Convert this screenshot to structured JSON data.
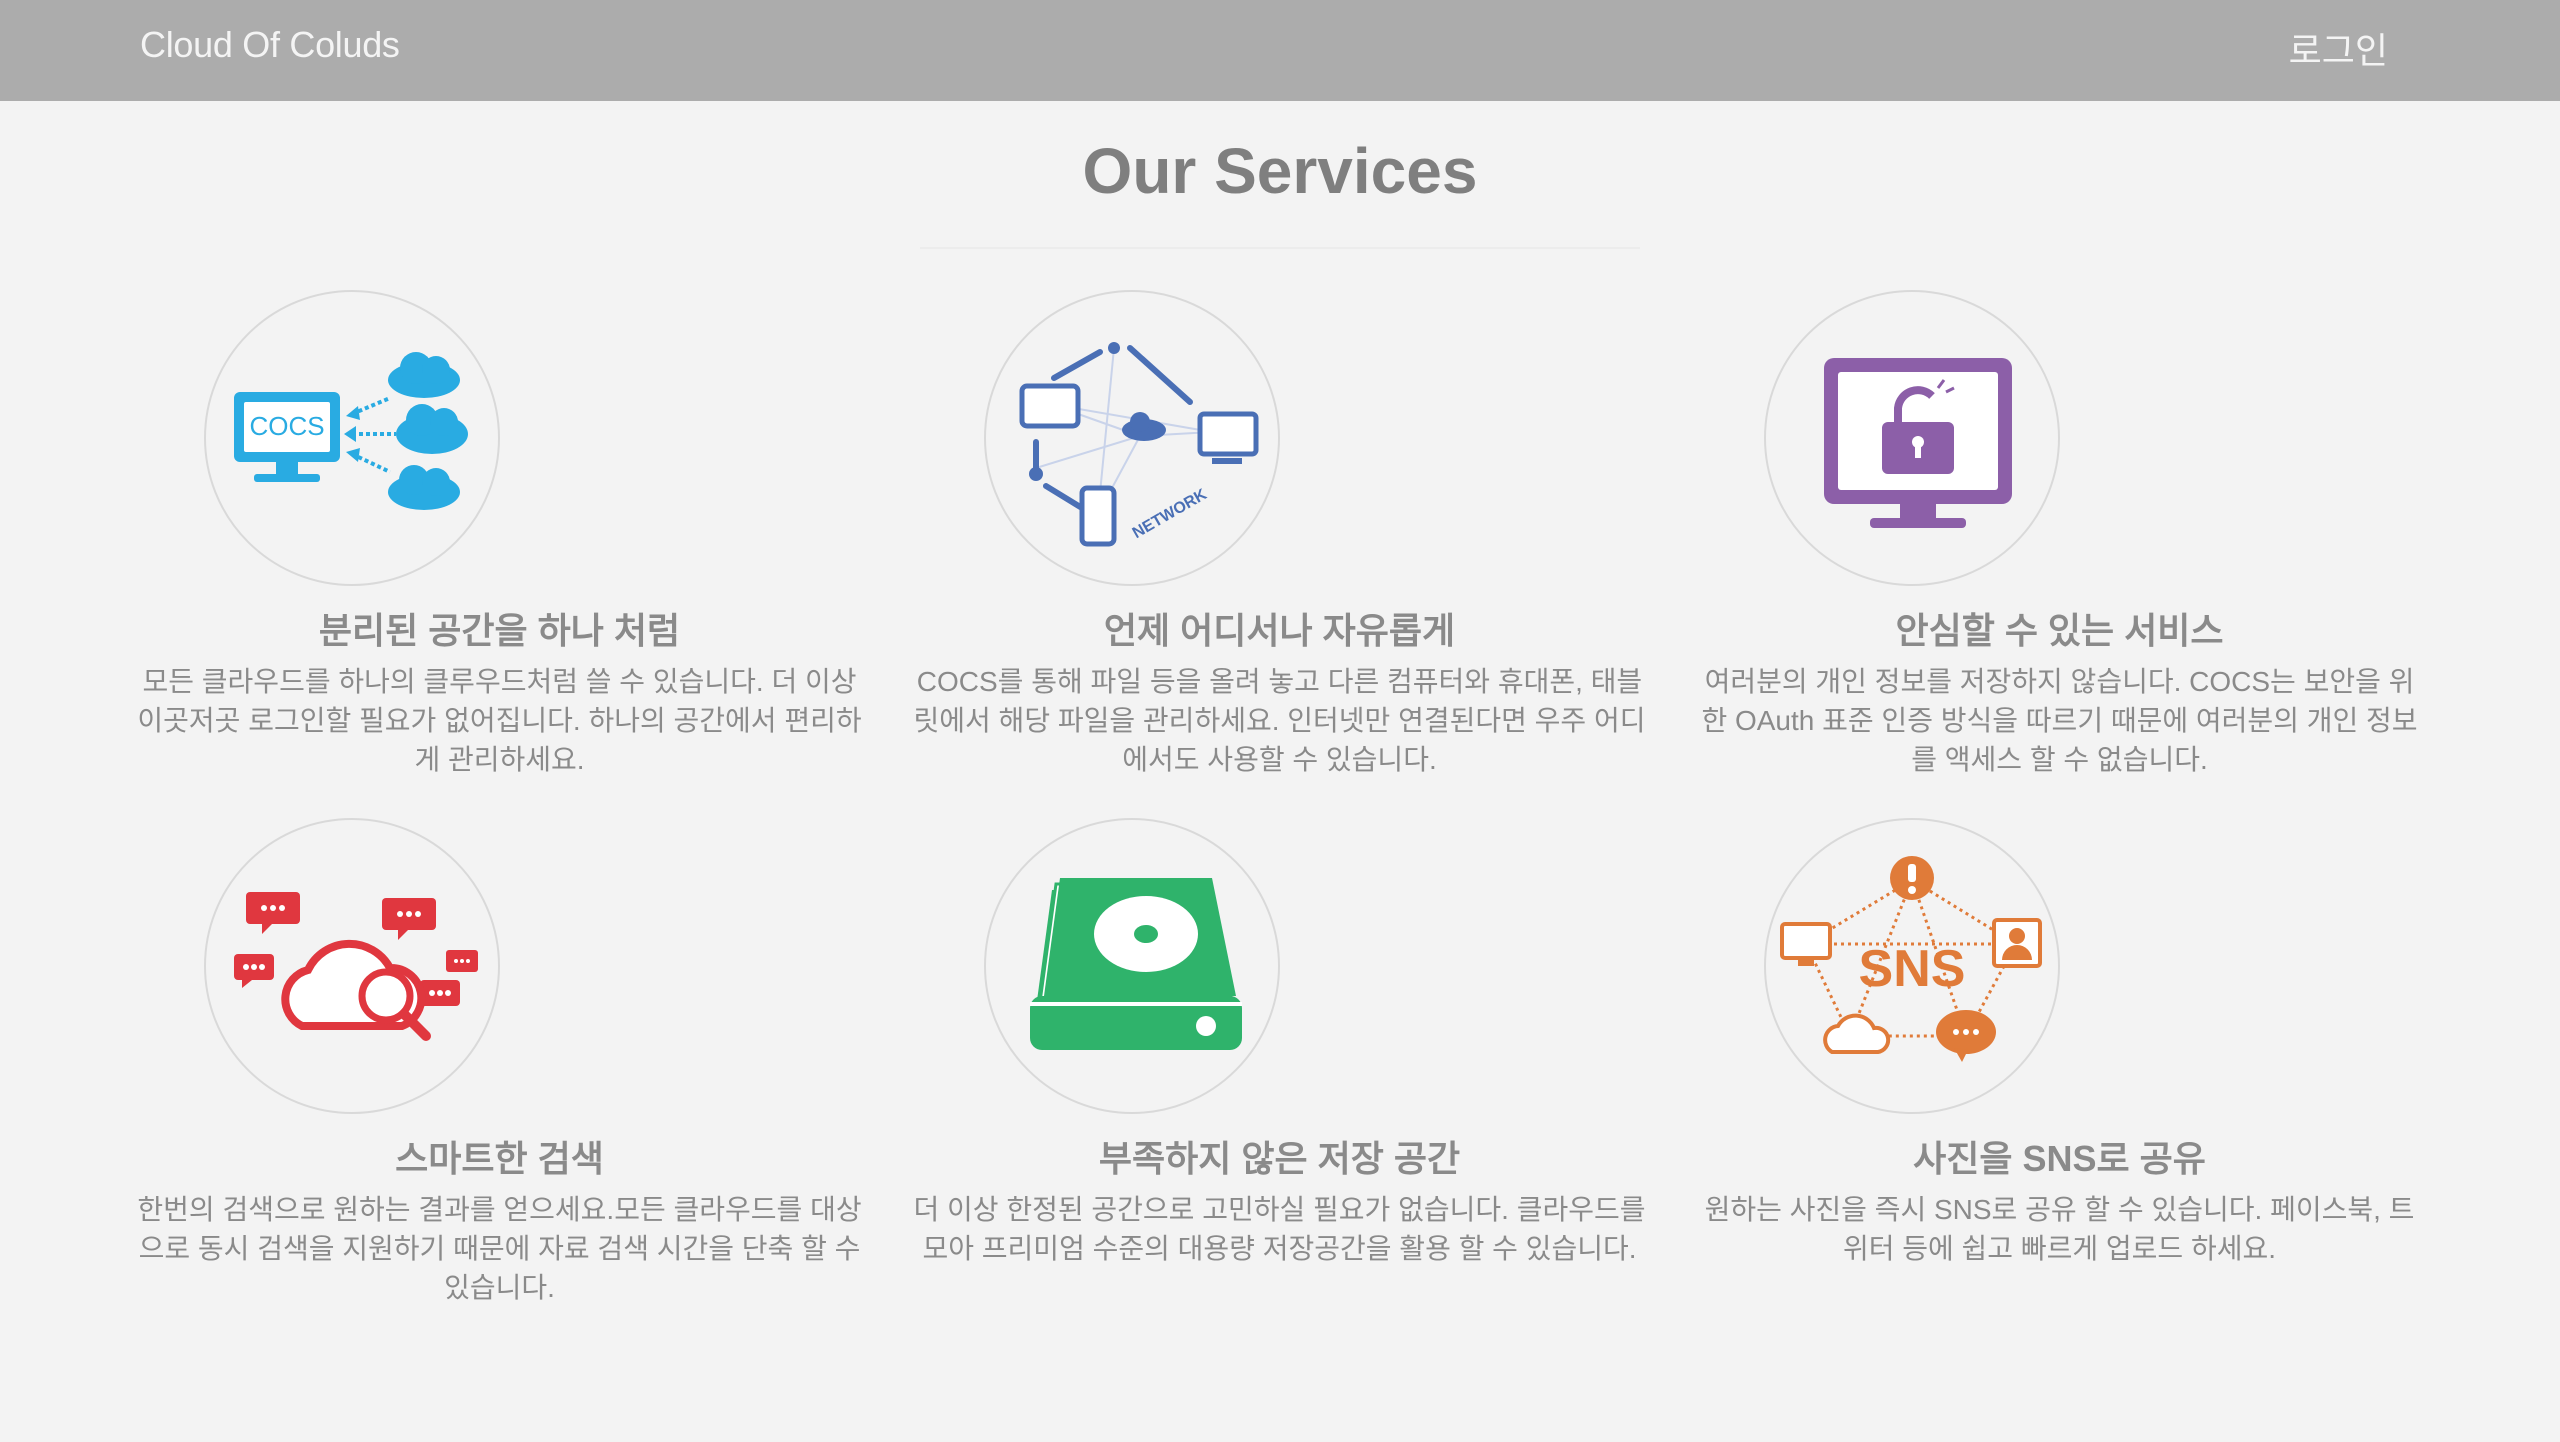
{
  "nav": {
    "brand": "Cloud Of Coluds",
    "login": "로그인"
  },
  "section_title": "Our Services",
  "services": [
    {
      "icon": "cloud-merge-icon",
      "icon_text": "COCS",
      "color": "#29abe2",
      "title": "분리된 공간을 하나 처럼",
      "desc": "모든 클라우드를 하나의 클루우드처럼 쓸 수 있습니다. 더 이상 이곳저곳 로그인할 필요가 없어집니다. 하나의 공간에서 편리하게 관리하세요."
    },
    {
      "icon": "network-icon",
      "icon_text": "NETWORK",
      "color": "#4a6fb5",
      "title": "언제 어디서나 자유롭게",
      "desc": "COCS를 통해 파일 등을 올려 놓고 다른 컴퓨터와 휴대폰, 태블릿에서 해당 파일을 관리하세요. 인터넷만 연결된다면 우주 어디에서도 사용할 수 있습니다."
    },
    {
      "icon": "secure-monitor-icon",
      "icon_text": "",
      "color": "#8c5fa8",
      "title": "안심할 수 있는 서비스",
      "desc": "여러분의 개인 정보를 저장하지 않습니다. COCS는 보안을 위한 OAuth 표준 인증 방식을 따르기 때문에 여러분의 개인 정보를 액세스 할 수 없습니다."
    },
    {
      "icon": "cloud-search-icon",
      "icon_text": "",
      "color": "#e0373f",
      "title": "스마트한 검색",
      "desc": "한번의 검색으로 원하는 결과를 얻으세요.모든 클라우드를 대상으로 동시 검색을 지원하기 때문에 자료 검색 시간을 단축 할 수 있습니다."
    },
    {
      "icon": "hard-drive-icon",
      "icon_text": "",
      "color": "#2fb36b",
      "title": "부족하지 않은 저장 공간",
      "desc": "더 이상 한정된 공간으로 고민하실 필요가 없습니다. 클라우드를 모아 프리미엄 수준의 대용량 저장공간을 활용 할 수 있습니다."
    },
    {
      "icon": "sns-share-icon",
      "icon_text": "SNS",
      "color": "#e07b39",
      "title": "사진을 SNS로 공유",
      "desc": "원하는 사진을 즉시 SNS로 공유 할 수 있습니다. 페이스북, 트위터 등에 쉽고 빠르게 업로드 하세요."
    }
  ]
}
